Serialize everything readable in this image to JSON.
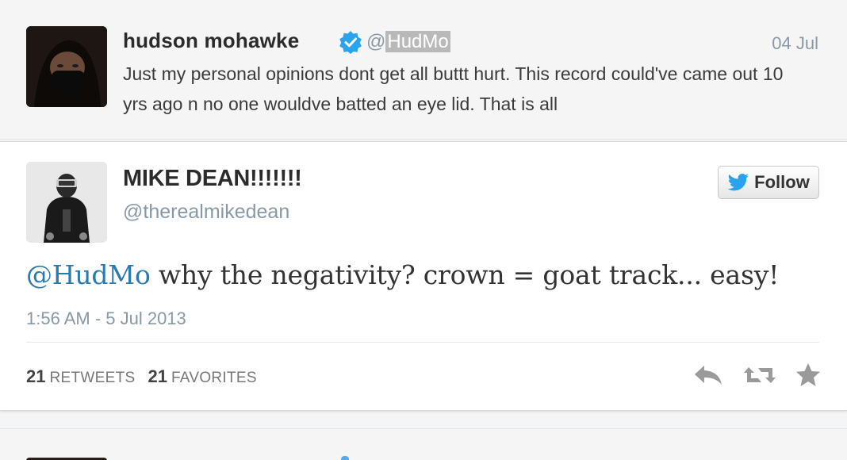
{
  "top_tweet": {
    "name": "hudson mohawke",
    "handle": "@HudMo",
    "handle_prefix": "@",
    "handle_highlighted": "HudMo",
    "date": "04 Jul",
    "text": "Just my personal opinions dont get all buttt hurt. This record could've came out 10 yrs ago n no one wouldve batted an eye lid. That is all",
    "verified_icon": "verified-badge-icon",
    "verified_color": "#2aa3ef"
  },
  "main_tweet": {
    "name": "MIKE DEAN!!!!!!!",
    "handle": "@therealmikedean",
    "follow_label": "Follow",
    "mention": "@HudMo",
    "text": " why the negativity? crown = goat track... easy!",
    "timestamp": "1:56 AM - 5 Jul 2013",
    "retweets_count": "21",
    "retweets_label": "RETWEETS",
    "favorites_count": "21",
    "favorites_label": "FAVORITES",
    "mention_color": "#2a7ab0",
    "follow_bird_color": "#2aa3ef",
    "action_icons": [
      "reply-icon",
      "retweet-icon",
      "favorite-icon"
    ]
  }
}
